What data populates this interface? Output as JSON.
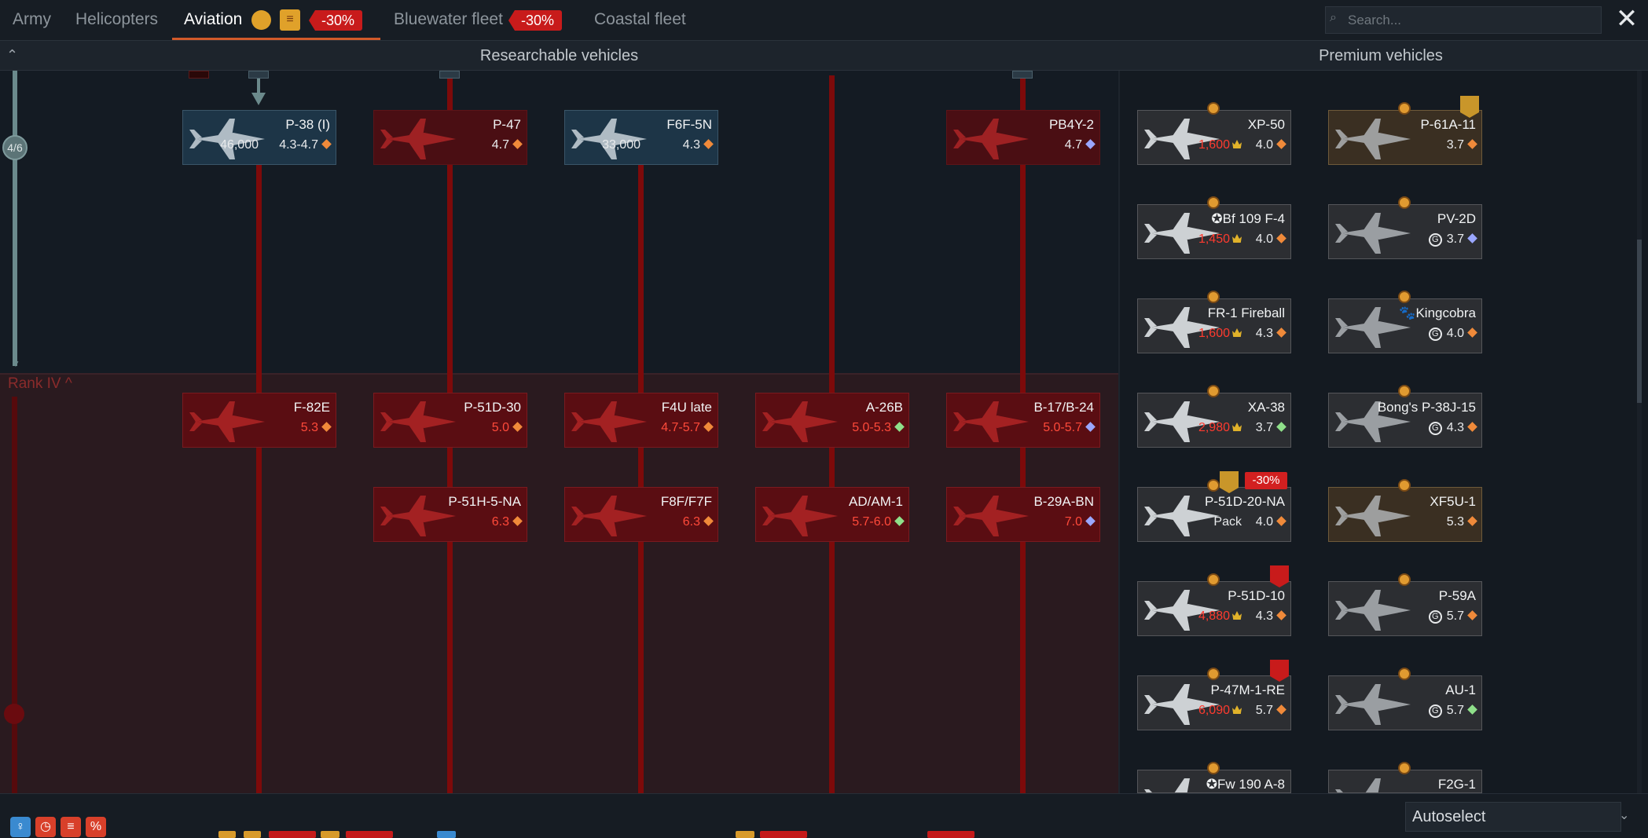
{
  "tabs": [
    {
      "label": "Army"
    },
    {
      "label": "Helicopters"
    },
    {
      "label": "Aviation"
    },
    {
      "label": "Bluewater fleet"
    },
    {
      "label": "Coastal fleet"
    }
  ],
  "aviation_discount": "-30%",
  "bluewater_discount": "-30%",
  "search": {
    "placeholder": "Search..."
  },
  "section": {
    "researchable": "Researchable vehicles",
    "premium": "Premium vehicles"
  },
  "progress": {
    "label": "4/6"
  },
  "rank_label": "Rank IV ^",
  "research": [
    {
      "name": "P-38 (I)",
      "cost": "46,000",
      "br": "4.3-4.7",
      "br_class": "d-orange",
      "state": "owned"
    },
    {
      "name": "P-47",
      "cost": "",
      "br": "4.7",
      "br_class": "d-orange",
      "state": "locked"
    },
    {
      "name": "F6F-5N",
      "cost": "33,000",
      "br": "4.3",
      "br_class": "d-orange",
      "state": "owned"
    },
    {
      "name": "PB4Y-2",
      "cost": "",
      "br": "4.7",
      "br_class": "d-blue",
      "state": "locked"
    },
    {
      "name": "F-82E",
      "cost": "",
      "br": "5.3",
      "br_class": "d-orange",
      "state": "red"
    },
    {
      "name": "P-51D-30",
      "cost": "",
      "br": "5.0",
      "br_class": "d-orange",
      "state": "red"
    },
    {
      "name": "F4U late",
      "cost": "",
      "br": "4.7-5.7",
      "br_class": "d-orange",
      "state": "red"
    },
    {
      "name": "A-26B",
      "cost": "",
      "br": "5.0-5.3",
      "br_class": "d-green",
      "state": "red"
    },
    {
      "name": "B-17/B-24",
      "cost": "",
      "br": "5.0-5.7",
      "br_class": "d-blue",
      "state": "red"
    },
    {
      "name": "P-51H-5-NA",
      "cost": "",
      "br": "6.3",
      "br_class": "d-orange",
      "state": "red"
    },
    {
      "name": "F8F/F7F",
      "cost": "",
      "br": "6.3",
      "br_class": "d-orange",
      "state": "red"
    },
    {
      "name": "AD/AM-1",
      "cost": "",
      "br": "5.7-6.0",
      "br_class": "d-green",
      "state": "red"
    },
    {
      "name": "B-29A-BN",
      "cost": "",
      "br": "7.0",
      "br_class": "d-blue",
      "state": "red"
    }
  ],
  "premium_left": [
    {
      "name": "XP-50",
      "cost": "1,600",
      "br": "4.0",
      "br_class": "d-orange"
    },
    {
      "name": "✪Bf 109 F-4",
      "cost": "1,450",
      "br": "4.0",
      "br_class": "d-orange"
    },
    {
      "name": "FR-1 Fireball",
      "cost": "1,600",
      "br": "4.3",
      "br_class": "d-orange"
    },
    {
      "name": "XA-38",
      "cost": "2,980",
      "br": "3.7",
      "br_class": "d-green"
    },
    {
      "name": "P-51D-20-NA",
      "cost": "Pack",
      "br": "4.0",
      "br_class": "d-orange"
    },
    {
      "name": "P-51D-10",
      "cost": "4,880",
      "br": "4.3",
      "br_class": "d-orange"
    },
    {
      "name": "P-47M-1-RE",
      "cost": "6,090",
      "br": "5.7",
      "br_class": "d-orange"
    },
    {
      "name": "✪Fw 190 A-8",
      "cost": "",
      "br": "",
      "br_class": "d-orange"
    }
  ],
  "premium_right": [
    {
      "name": "P-61A-11",
      "br": "3.7",
      "br_class": "d-orange",
      "gold": ""
    },
    {
      "name": "PV-2D",
      "br": "3.7",
      "br_class": "d-blue",
      "gold": "G"
    },
    {
      "name": "🐾Kingcobra",
      "br": "4.0",
      "br_class": "d-orange",
      "gold": "G"
    },
    {
      "name": "Bong's P-38J-15",
      "br": "4.3",
      "br_class": "d-orange",
      "gold": "G"
    },
    {
      "name": "XF5U-1",
      "br": "5.3",
      "br_class": "d-orange",
      "gold": ""
    },
    {
      "name": "P-59A",
      "br": "5.7",
      "br_class": "d-orange",
      "gold": "G"
    },
    {
      "name": "AU-1",
      "br": "5.7",
      "br_class": "d-green",
      "gold": "G"
    },
    {
      "name": "F2G-1",
      "br": "",
      "br_class": "d-orange",
      "gold": ""
    }
  ],
  "premium_discount": "-30%",
  "autoselect": "Autoselect",
  "colors": {
    "accent": "#d25a2a",
    "discount": "#c81b1b",
    "locked": "#5a0d12",
    "owned": "#1d3547"
  }
}
